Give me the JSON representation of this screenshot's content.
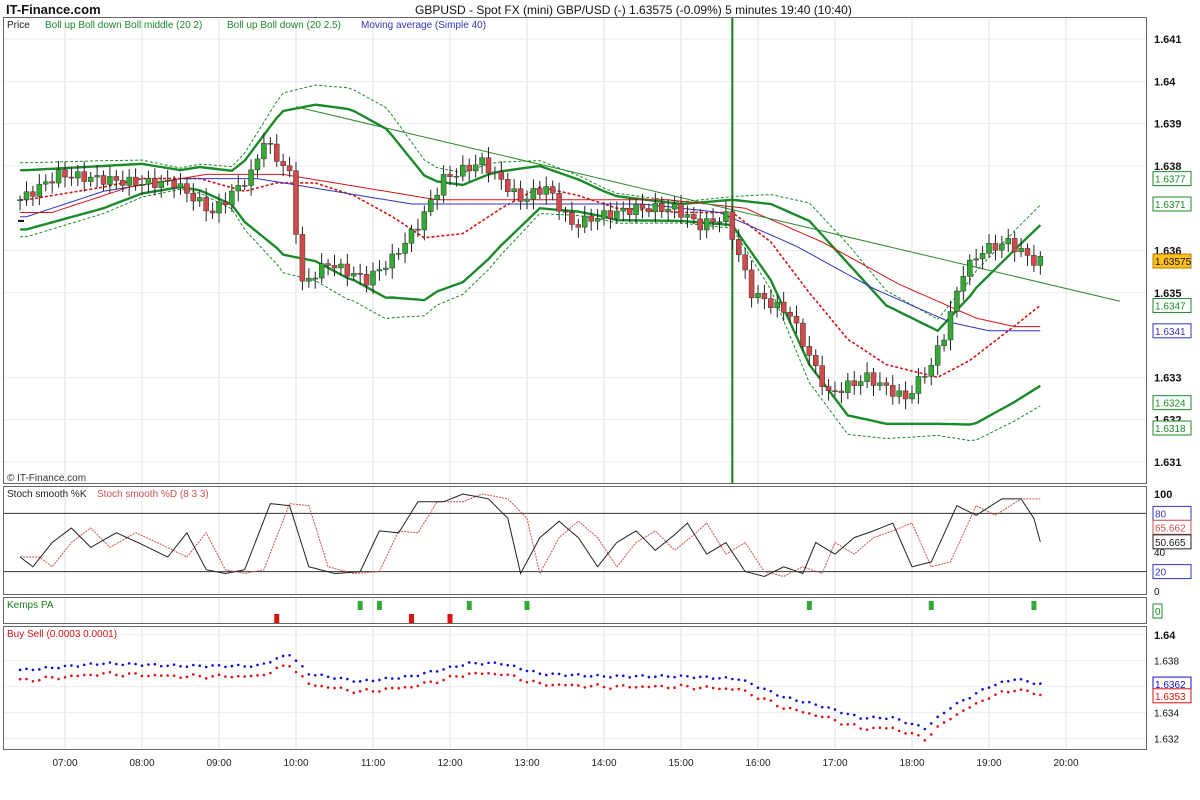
{
  "header": {
    "brand": "IT-Finance.com",
    "title": "GBPUSD - Spot FX (mini) GBP/USD (-)   1.63575 (-0.09%)    5 minutes  19:40 (10:40)"
  },
  "colors": {
    "up_candle": "#33aa33",
    "down_candle": "#d04a4a",
    "bollinger": "#1a8a2a",
    "moving_average": "#3333bb",
    "red_ma": "#d01818",
    "trendline": "#2a8a2a",
    "stoch_k": "#222222",
    "stoch_d": "#d05050",
    "buy_dots": "#1010d0",
    "sell_dots": "#e01010",
    "vline": "#1a7a1a"
  },
  "price_panel": {
    "legend": [
      {
        "text": "Price",
        "color": "#222222"
      },
      {
        "text": "Boll up  Boll down  Boll middle (20 2)",
        "color": "#1a8a2a"
      },
      {
        "text": "Boll up  Boll down (20 2.5)",
        "color": "#1a8a2a"
      },
      {
        "text": "Moving average (Simple 40)",
        "color": "#3333bb"
      }
    ],
    "watermark": "© IT-Finance.com",
    "tags": [
      {
        "text": "1.6377",
        "value": 1.6377,
        "color": "#1a8a2a"
      },
      {
        "text": "1.6371",
        "value": 1.6371,
        "color": "#1a8a2a"
      },
      {
        "text": "1.63575",
        "value": 1.63575,
        "color": "#ffc020"
      },
      {
        "text": "1.6347",
        "value": 1.6347,
        "color": "#1a8a2a"
      },
      {
        "text": "1.6341",
        "value": 1.6341,
        "color": "#3333bb"
      },
      {
        "text": "1.6324",
        "value": 1.6324,
        "color": "#1a8a2a"
      },
      {
        "text": "1.6318",
        "value": 1.6318,
        "color": "#1a8a2a"
      }
    ]
  },
  "stoch_panel": {
    "legend_k": "Stoch smooth %K",
    "legend_d": "Stoch smooth %D (8 3 3)",
    "tags": [
      {
        "text": "80",
        "value": 80,
        "color": "#3333bb"
      },
      {
        "text": "65.662",
        "value": 65.662,
        "color": "#d05050"
      },
      {
        "text": "50.665",
        "value": 50.665,
        "color": "#222222"
      },
      {
        "text": "20",
        "value": 20,
        "color": "#3333bb"
      }
    ]
  },
  "kemps_panel": {
    "legend": "Kemps PA",
    "tag": "0"
  },
  "buysell_panel": {
    "legend": "Buy Sell (0.0003 0.0001)",
    "tags": [
      {
        "text": "1.6362",
        "value": 1.6362,
        "color": "#1010d0"
      },
      {
        "text": "1.6353",
        "value": 1.6353,
        "color": "#e01010"
      }
    ]
  },
  "chart_data": {
    "type": "candlestick",
    "interval": "5 minutes",
    "symbol": "GBPUSD",
    "last": 1.63575,
    "change_pct": "-0.09%",
    "x_ticks": [
      "07:00",
      "08:00",
      "09:00",
      "10:00",
      "11:00",
      "12:00",
      "13:00",
      "14:00",
      "15:00",
      "16:00",
      "17:00",
      "18:00",
      "19:00",
      "20:00"
    ],
    "price_axis": {
      "ticks": [
        "1.641",
        "1.64",
        "1.639",
        "1.638",
        "1.636",
        "1.635",
        "1.633",
        "1.632",
        "1.631"
      ],
      "ylim": [
        1.6305,
        1.6415
      ]
    },
    "stoch_axis": {
      "ticks": [
        "100",
        "80",
        "40",
        "20",
        "0"
      ],
      "ylim": [
        0,
        100
      ]
    },
    "buysell_axis": {
      "ticks": [
        "1.64",
        "1.638",
        "1.636",
        "1.634",
        "1.632"
      ],
      "ylim": [
        1.6312,
        1.6406
      ]
    },
    "trendline": {
      "from": {
        "time": "10:00",
        "price": 1.6394
      },
      "to": {
        "time": "19:40",
        "price": 1.6353
      }
    },
    "vertical_line_time": "15:40",
    "candle_anchors": [
      [
        "06:30",
        1.6372
      ],
      [
        "07:00",
        1.6378
      ],
      [
        "07:30",
        1.6377
      ],
      [
        "08:00",
        1.6376
      ],
      [
        "08:30",
        1.6376
      ],
      [
        "09:00",
        1.6369
      ],
      [
        "09:30",
        1.6378
      ],
      [
        "09:40",
        1.6386
      ],
      [
        "10:00",
        1.6378
      ],
      [
        "10:10",
        1.6352
      ],
      [
        "10:30",
        1.6357
      ],
      [
        "11:00",
        1.6353
      ],
      [
        "11:20",
        1.6358
      ],
      [
        "11:40",
        1.6366
      ],
      [
        "12:00",
        1.6377
      ],
      [
        "12:30",
        1.6381
      ],
      [
        "13:00",
        1.6372
      ],
      [
        "13:20",
        1.6375
      ],
      [
        "13:40",
        1.6366
      ],
      [
        "14:00",
        1.6368
      ],
      [
        "14:30",
        1.637
      ],
      [
        "15:00",
        1.637
      ],
      [
        "15:20",
        1.6366
      ],
      [
        "15:40",
        1.6368
      ],
      [
        "16:00",
        1.635
      ],
      [
        "16:30",
        1.6345
      ],
      [
        "16:45",
        1.6335
      ],
      [
        "17:00",
        1.6326
      ],
      [
        "17:30",
        1.633
      ],
      [
        "18:00",
        1.6325
      ],
      [
        "18:20",
        1.6333
      ],
      [
        "18:30",
        1.634
      ],
      [
        "18:45",
        1.6355
      ],
      [
        "19:00",
        1.636
      ],
      [
        "19:20",
        1.6362
      ],
      [
        "19:40",
        1.63575
      ]
    ],
    "boll_mid_anchors": [
      [
        "06:30",
        1.6372
      ],
      [
        "07:30",
        1.6375
      ],
      [
        "08:00",
        1.6377
      ],
      [
        "08:45",
        1.6377
      ],
      [
        "09:20",
        1.6374
      ],
      [
        "09:45",
        1.6376
      ],
      [
        "10:15",
        1.6376
      ],
      [
        "10:45",
        1.6373
      ],
      [
        "11:15",
        1.6368
      ],
      [
        "11:40",
        1.6363
      ],
      [
        "12:10",
        1.6364
      ],
      [
        "12:40",
        1.637
      ],
      [
        "13:10",
        1.6375
      ],
      [
        "13:40",
        1.6373
      ],
      [
        "14:10",
        1.637
      ],
      [
        "15:00",
        1.6369
      ],
      [
        "15:40",
        1.6369
      ],
      [
        "16:10",
        1.6362
      ],
      [
        "16:40",
        1.635
      ],
      [
        "17:10",
        1.6339
      ],
      [
        "17:40",
        1.6333
      ],
      [
        "18:20",
        1.633
      ],
      [
        "18:45",
        1.6334
      ],
      [
        "19:15",
        1.6341
      ],
      [
        "19:40",
        1.6347
      ]
    ],
    "boll_width_anchors": [
      [
        "06:30",
        0.0007
      ],
      [
        "07:30",
        0.0005
      ],
      [
        "08:30",
        0.0002
      ],
      [
        "09:10",
        0.0004
      ],
      [
        "09:50",
        0.0017
      ],
      [
        "10:40",
        0.002
      ],
      [
        "11:10",
        0.002
      ],
      [
        "11:50",
        0.0013
      ],
      [
        "12:30",
        0.001
      ],
      [
        "13:10",
        0.0005
      ],
      [
        "14:00",
        0.0003
      ],
      [
        "15:00",
        0.0002
      ],
      [
        "15:40",
        0.0003
      ],
      [
        "16:10",
        0.0009
      ],
      [
        "16:40",
        0.0017
      ],
      [
        "17:10",
        0.0018
      ],
      [
        "17:40",
        0.0014
      ],
      [
        "18:20",
        0.0011
      ],
      [
        "18:50",
        0.0016
      ],
      [
        "19:20",
        0.0018
      ],
      [
        "19:40",
        0.0019
      ]
    ],
    "ma40_anchors": [
      [
        "06:30",
        1.6368
      ],
      [
        "07:30",
        1.6374
      ],
      [
        "08:30",
        1.6377
      ],
      [
        "09:30",
        1.6377
      ],
      [
        "10:30",
        1.6374
      ],
      [
        "11:30",
        1.6371
      ],
      [
        "12:30",
        1.6371
      ],
      [
        "13:30",
        1.6371
      ],
      [
        "14:30",
        1.6371
      ],
      [
        "15:30",
        1.6369
      ],
      [
        "16:30",
        1.6361
      ],
      [
        "17:30",
        1.6351
      ],
      [
        "18:30",
        1.6343
      ],
      [
        "19:00",
        1.6341
      ],
      [
        "19:40",
        1.6341
      ]
    ],
    "stoch_k_anchors": [
      [
        "06:25",
        35
      ],
      [
        "06:35",
        25
      ],
      [
        "06:50",
        50
      ],
      [
        "07:05",
        65
      ],
      [
        "07:20",
        45
      ],
      [
        "07:40",
        60
      ],
      [
        "08:00",
        48
      ],
      [
        "08:20",
        35
      ],
      [
        "08:35",
        60
      ],
      [
        "08:50",
        22
      ],
      [
        "09:05",
        18
      ],
      [
        "09:20",
        22
      ],
      [
        "09:40",
        90
      ],
      [
        "09:55",
        88
      ],
      [
        "10:10",
        25
      ],
      [
        "10:30",
        18
      ],
      [
        "10:50",
        20
      ],
      [
        "11:05",
        62
      ],
      [
        "11:20",
        60
      ],
      [
        "11:35",
        92
      ],
      [
        "11:55",
        92
      ],
      [
        "12:10",
        100
      ],
      [
        "12:30",
        95
      ],
      [
        "12:45",
        75
      ],
      [
        "12:55",
        18
      ],
      [
        "13:10",
        55
      ],
      [
        "13:25",
        72
      ],
      [
        "13:40",
        55
      ],
      [
        "13:55",
        25
      ],
      [
        "14:10",
        50
      ],
      [
        "14:25",
        62
      ],
      [
        "14:40",
        42
      ],
      [
        "14:55",
        58
      ],
      [
        "15:05",
        70
      ],
      [
        "15:20",
        38
      ],
      [
        "15:35",
        50
      ],
      [
        "15:50",
        20
      ],
      [
        "16:05",
        15
      ],
      [
        "16:20",
        25
      ],
      [
        "16:35",
        18
      ],
      [
        "16:45",
        50
      ],
      [
        "17:00",
        38
      ],
      [
        "17:15",
        55
      ],
      [
        "17:30",
        62
      ],
      [
        "17:45",
        70
      ],
      [
        "18:00",
        25
      ],
      [
        "18:15",
        30
      ],
      [
        "18:35",
        88
      ],
      [
        "18:50",
        78
      ],
      [
        "19:10",
        95
      ],
      [
        "19:25",
        95
      ],
      [
        "19:35",
        75
      ],
      [
        "19:40",
        50.665
      ]
    ],
    "stoch_d_lag": 3,
    "kemps_marks": [
      {
        "time": "10:50",
        "kind": "buy"
      },
      {
        "time": "11:05",
        "kind": "buy"
      },
      {
        "time": "09:45",
        "kind": "sell"
      },
      {
        "time": "11:30",
        "kind": "sell"
      },
      {
        "time": "12:00",
        "kind": "sell"
      },
      {
        "time": "12:15",
        "kind": "buy"
      },
      {
        "time": "13:00",
        "kind": "buy"
      },
      {
        "time": "16:40",
        "kind": "buy"
      },
      {
        "time": "18:15",
        "kind": "buy"
      },
      {
        "time": "19:35",
        "kind": "buy"
      }
    ],
    "buy_dots_anchors": [
      [
        "06:30",
        1.6373
      ],
      [
        "07:30",
        1.6378
      ],
      [
        "08:30",
        1.6376
      ],
      [
        "09:30",
        1.6376
      ],
      [
        "09:55",
        1.6385
      ],
      [
        "10:10",
        1.637
      ],
      [
        "10:50",
        1.6364
      ],
      [
        "11:30",
        1.6368
      ],
      [
        "12:15",
        1.6378
      ],
      [
        "12:40",
        1.6378
      ],
      [
        "13:10",
        1.637
      ],
      [
        "14:00",
        1.6368
      ],
      [
        "14:30",
        1.6368
      ],
      [
        "15:00",
        1.6368
      ],
      [
        "15:45",
        1.6366
      ],
      [
        "16:20",
        1.6352
      ],
      [
        "16:50",
        1.6345
      ],
      [
        "17:20",
        1.6336
      ],
      [
        "17:45",
        1.6336
      ],
      [
        "18:10",
        1.6328
      ],
      [
        "18:30",
        1.6344
      ],
      [
        "19:00",
        1.636
      ],
      [
        "19:20",
        1.6366
      ],
      [
        "19:40",
        1.6362
      ]
    ],
    "sell_offset": 0.0008
  }
}
